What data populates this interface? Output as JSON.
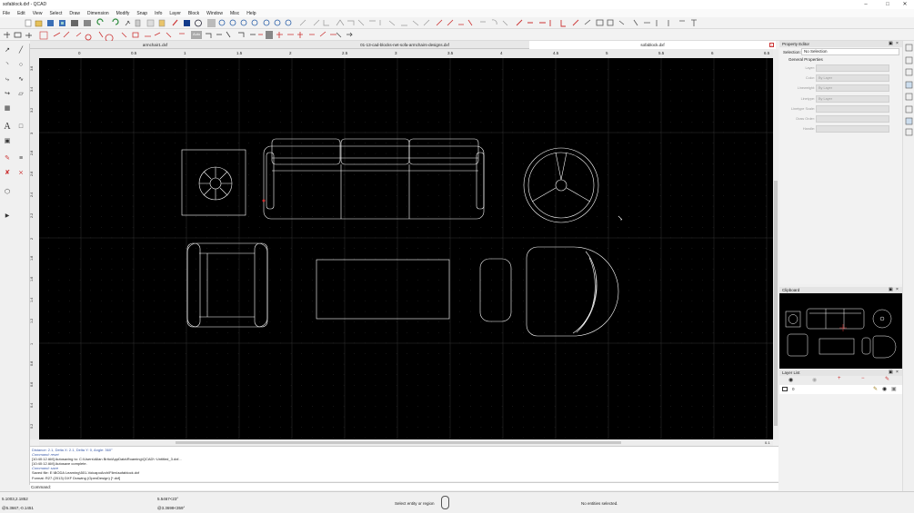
{
  "window": {
    "title": "sofablock.dxf - QCAD"
  },
  "menu": [
    "File",
    "Edit",
    "View",
    "Select",
    "Draw",
    "Dimension",
    "Modify",
    "Snap",
    "Info",
    "Layer",
    "Block",
    "Window",
    "Misc",
    "Help"
  ],
  "snap_auto_label": "Auto",
  "tabs": [
    {
      "label": "armchair1.dxf"
    },
    {
      "label": "01-13-cad-blocks-net-sofa-armchairs-designs.dxf"
    },
    {
      "label": "sofablock.dxf"
    }
  ],
  "ruler": {
    "h_labels": [
      "0",
      "0.5",
      "1",
      "1.5",
      "2",
      "2.5",
      "3",
      "3.5",
      "4",
      "4.5",
      "5",
      "5.5",
      "6",
      "6.5"
    ],
    "v_labels": [
      "3.6",
      "3.4",
      "3.2",
      "3",
      "2.8",
      "2.6",
      "2.4",
      "2.2",
      "2",
      "1.8",
      "1.6",
      "1.4",
      "1.2",
      "1",
      "0.8",
      "0.6",
      "0.4",
      "0.2"
    ]
  },
  "scroll_readout": "0.1",
  "command_log": [
    "Distance: 2.1, Delta X: 2.1, Delta Y: 0, Angle: 360°",
    "Command: reset",
    "[10:40:12 AM] Autosaving to: C:\\Users\\Allan Brito\\AppData\\Roaming\\QCAD\\~Untitled_3.dxf...",
    "[10:40:12 AM] Autosave complete.",
    "Command: save",
    "Saved file: E:\\BODA Learning\\501-VoicapoArch\\Files\\sofablock.dxf",
    "Format: R27 (2013) DXF Drawing (OpenDesign) [*.dxf]"
  ],
  "command_prompt": "Command:",
  "status": {
    "abs_coord": "5.1003,2.1852",
    "rel_coord": "@5.3667,-0.1451",
    "polar_coord": "5.5467<23°",
    "rel_polar": "@3.3698<359°",
    "hint": "Select entity or region",
    "selection": "No entities selected."
  },
  "property_editor": {
    "title": "Property Editor",
    "selection_label": "Selection:",
    "selection_value": "No Selection",
    "section": "General Properties",
    "rows": [
      {
        "label": "Layer:",
        "value": ""
      },
      {
        "label": "Color:",
        "value": "By Layer"
      },
      {
        "label": "Lineweight:",
        "value": "By Layer"
      },
      {
        "label": "Linetype:",
        "value": "By Layer"
      },
      {
        "label": "Linetype Scale:",
        "value": ""
      },
      {
        "label": "Draw Order:",
        "value": ""
      },
      {
        "label": "Handle:",
        "value": ""
      }
    ]
  },
  "clipboard": {
    "title": "Clipboard"
  },
  "layer_list": {
    "title": "Layer List",
    "layers": [
      {
        "name": "0"
      }
    ]
  },
  "colors": {
    "canvas_bg": "#000000",
    "entity": "#ffffff",
    "grid": "#3a3a3a"
  }
}
